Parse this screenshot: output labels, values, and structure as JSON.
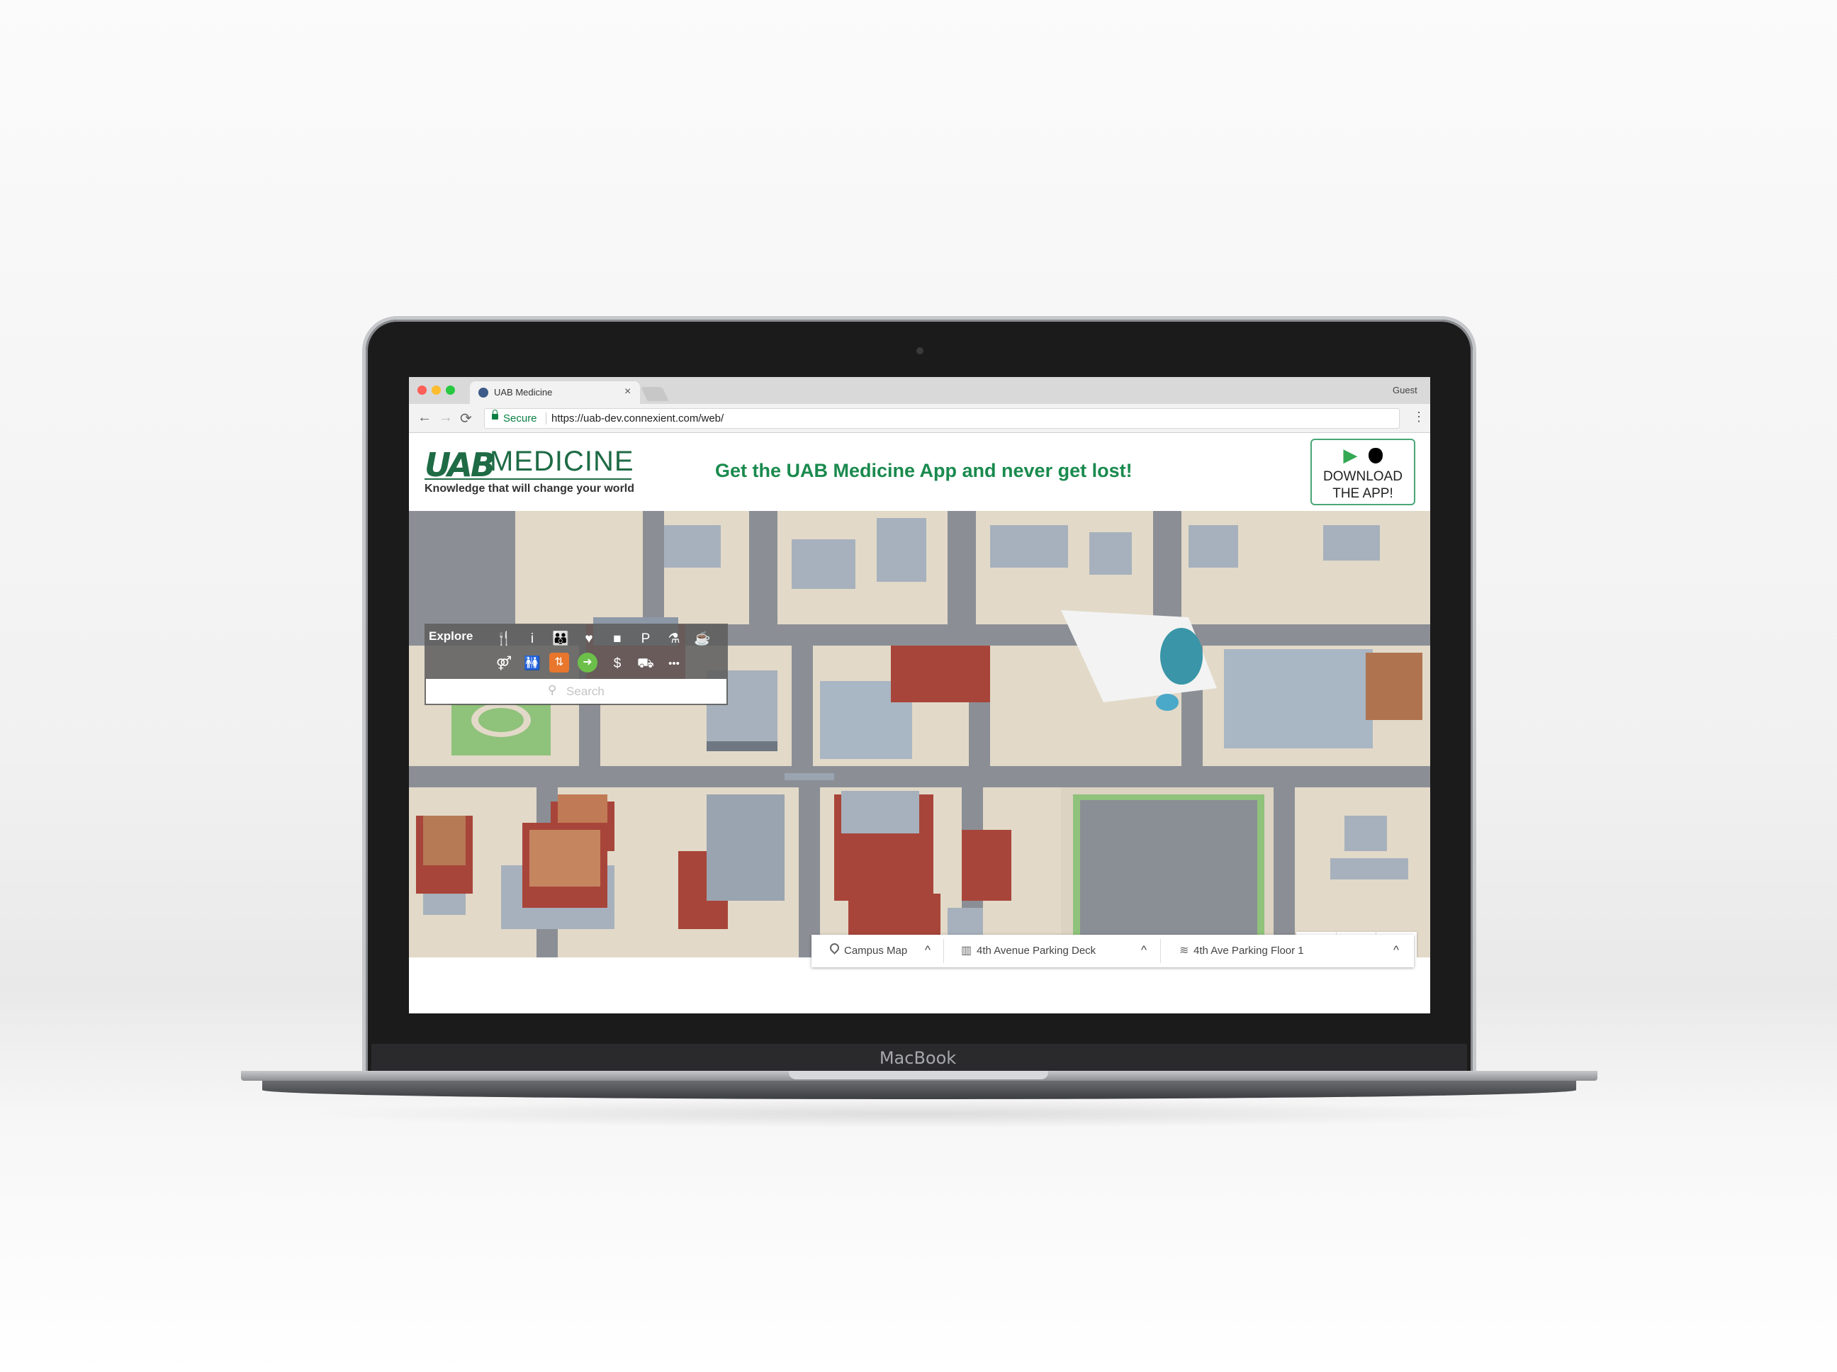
{
  "device": {
    "brand_label": "MacBook"
  },
  "browser": {
    "tab_title": "UAB Medicine",
    "tab_close": "×",
    "profile": "Guest",
    "secure_label": "Secure",
    "url": "https://uab-dev.connexient.com/web/",
    "nav": {
      "back": "←",
      "forward": "→",
      "reload": "⟳",
      "menu": "⋮"
    }
  },
  "header": {
    "logo_uab": "UAB",
    "logo_medicine": "MEDICINE",
    "tagline": "Knowledge that will change your world",
    "promo": "Get the UAB Medicine App and never get lost!",
    "download": {
      "icons": "▶ ",
      "line1": "DOWNLOAD",
      "line2": "THE APP!"
    }
  },
  "explore": {
    "title": "Explore",
    "search_placeholder": "Search",
    "search_icon": "⚲",
    "row1": [
      {
        "name": "dining-icon",
        "glyph": "🍴"
      },
      {
        "name": "info-icon",
        "glyph": "i"
      },
      {
        "name": "family-icon",
        "glyph": "👪"
      },
      {
        "name": "heart-icon",
        "glyph": "♥"
      },
      {
        "name": "building-icon",
        "glyph": "■"
      },
      {
        "name": "parking-icon",
        "glyph": "P"
      },
      {
        "name": "pharmacy-icon",
        "glyph": "⚗"
      },
      {
        "name": "coffee-icon",
        "glyph": "☕"
      }
    ],
    "row2": [
      {
        "name": "restroom-family-icon",
        "glyph": "⚤"
      },
      {
        "name": "restroom-icon",
        "glyph": "🚻"
      },
      {
        "name": "elevator-icon",
        "glyph": "⇅",
        "badge": "#e8762d"
      },
      {
        "name": "exit-icon",
        "glyph": "➜",
        "badge": "#6cc04a"
      },
      {
        "name": "atm-icon",
        "glyph": "$"
      },
      {
        "name": "shuttle-icon",
        "glyph": "⛟"
      },
      {
        "name": "more-icon",
        "glyph": "•••"
      }
    ]
  },
  "zoom": {
    "in": "+",
    "out": "−",
    "tilt": "∠°"
  },
  "levels": [
    {
      "name": "campus",
      "icon": "📍",
      "label": "Campus Map",
      "chevron": "^"
    },
    {
      "name": "building",
      "icon": "▥",
      "label": "4th Avenue Parking Deck",
      "chevron": "^"
    },
    {
      "name": "floor",
      "icon": "≋",
      "label": "4th Ave Parking Floor 1",
      "chevron": "^"
    }
  ],
  "colors": {
    "brand_green": "#1e6b45",
    "promo_green": "#1a8a4e",
    "road": "#8b8f95",
    "sidewalk": "#e2d9c8",
    "grass": "#8fc27a",
    "brick": "#a8453a",
    "roof_gray": "#a7b1bd",
    "elevator_orange": "#e8762d",
    "exit_green": "#6cc04a"
  }
}
